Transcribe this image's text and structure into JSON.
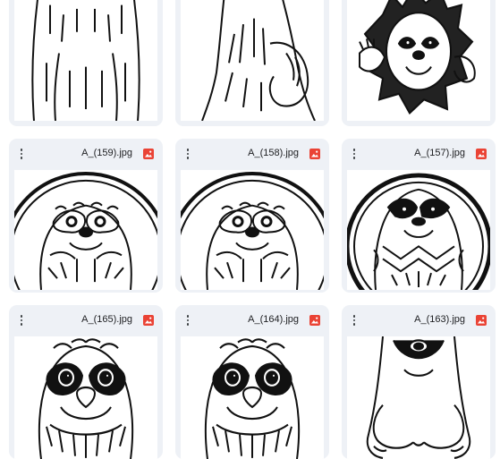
{
  "files": [
    {
      "name": ""
    },
    {
      "name": ""
    },
    {
      "name": ""
    },
    {
      "name": "A_(159).jpg"
    },
    {
      "name": "A_(158).jpg"
    },
    {
      "name": "A_(157).jpg"
    },
    {
      "name": "A_(165).jpg"
    },
    {
      "name": "A_(164).jpg"
    },
    {
      "name": "A_(163).jpg"
    }
  ],
  "icons": {
    "more": "more-vert-icon",
    "filetype": "image-file-icon"
  },
  "colors": {
    "filetype_icon": "#ea4335",
    "card_bg": "#eef1f6"
  }
}
